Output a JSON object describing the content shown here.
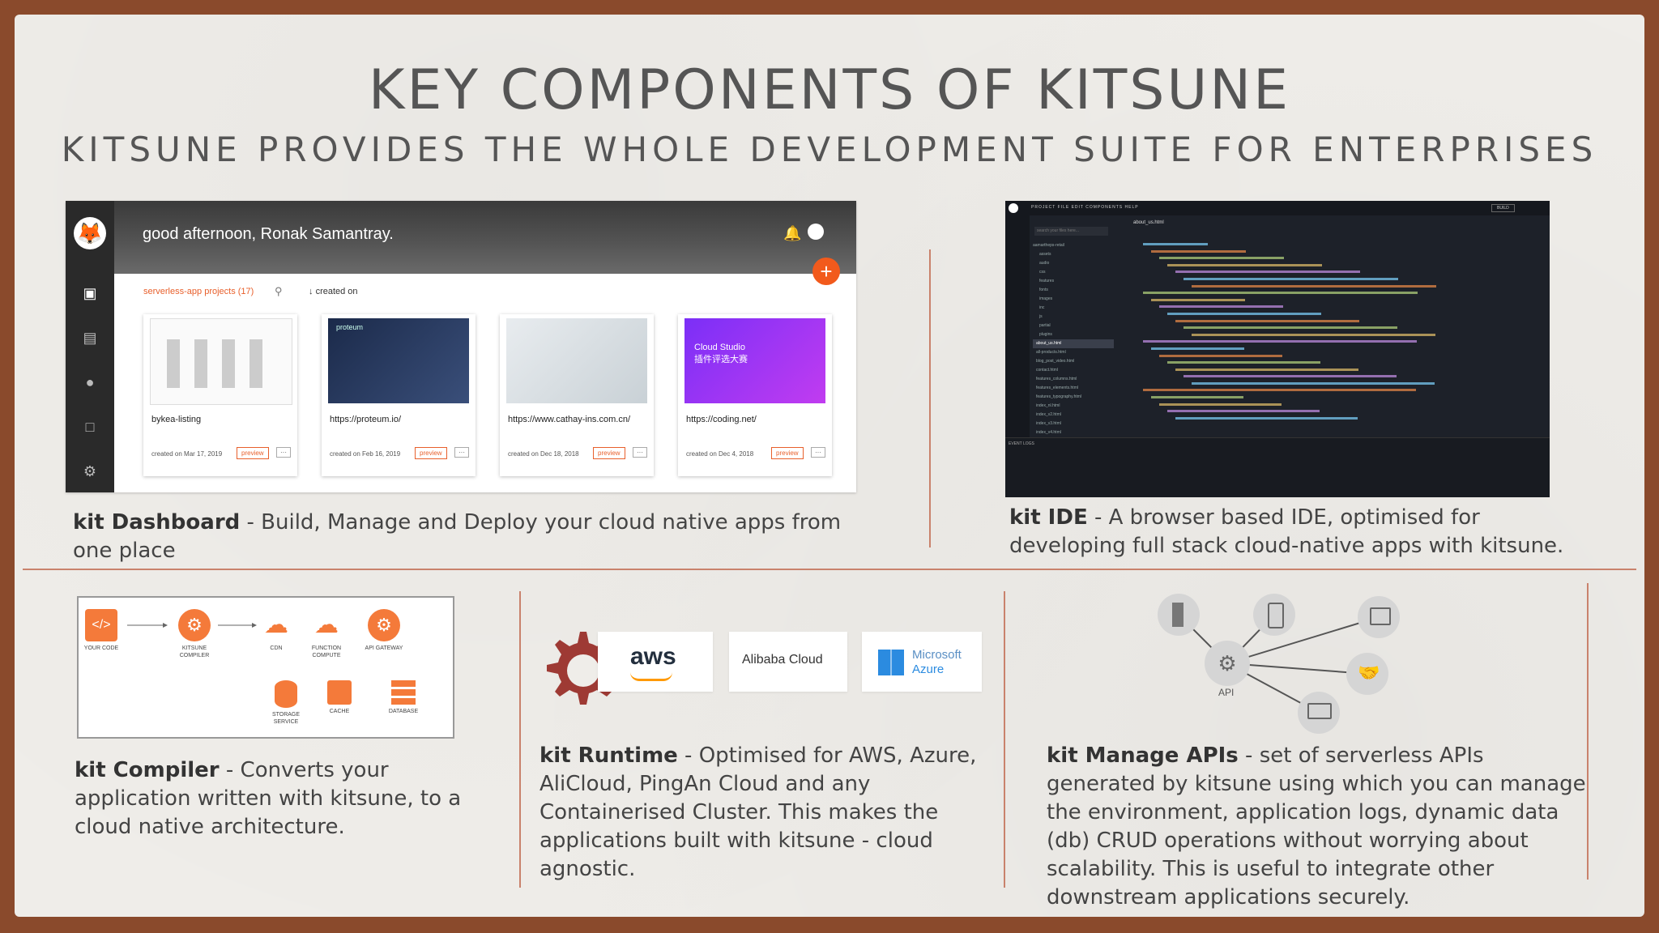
{
  "slide": {
    "title": "KEY COMPONENTS OF KITSUNE",
    "subtitle": "KITSUNE PROVIDES THE WHOLE DEVELOPMENT SUITE FOR ENTERPRISES"
  },
  "dashboard": {
    "greeting": "good afternoon, Ronak Samantray.",
    "filter_label": "serverless-app projects (17)",
    "sort_label": "created on",
    "cards": [
      {
        "name": "bykea-listing",
        "date": "created on Mar 17, 2019",
        "preview": "preview"
      },
      {
        "name": "https://proteum.io/",
        "date": "created on Feb 16, 2019",
        "preview": "preview"
      },
      {
        "name": "https://www.cathay-ins.com.cn/",
        "date": "created on Dec 18, 2018",
        "preview": "preview"
      },
      {
        "name": "https://coding.net/",
        "date": "created on Dec 4, 2018",
        "preview": "preview"
      }
    ],
    "card2_thumb_text": "proteum",
    "card4_thumb_text": "Cloud Studio\n插件评选大赛"
  },
  "captions": {
    "dashboard_bold": "kit Dashboard",
    "dashboard_text": " - Build, Manage and Deploy your cloud native apps from one place",
    "ide_bold": "kit IDE",
    "ide_text": " - A browser based IDE, optimised for developing full stack cloud-native apps with kitsune.",
    "compiler_bold": "kit Compiler",
    "compiler_text": " - Converts your application written with kitsune, to a cloud native architecture.",
    "runtime_bold": "kit Runtime",
    "runtime_text": " - Optimised for AWS, Azure, AliCloud, PingAn Cloud and any Containerised Cluster. This makes the applications built with kitsune - cloud agnostic.",
    "apis_bold": "kit Manage APIs",
    "apis_text": " - set of serverless APIs generated by kitsune using which you can manage the environment, application logs, dynamic data (db) CRUD operations without worrying about scalability. This is useful to integrate other downstream applications securely."
  },
  "ide": {
    "menu": "PROJECT   FILE   EDIT   COMPONENTS   HELP",
    "build": "BUILD",
    "tab": "about_us.html",
    "search_placeholder": "search your files here...",
    "tree": [
      "aamartheps-retail",
      "assets",
      "audio",
      "css",
      "features",
      "fonts",
      "images",
      "inc",
      "js",
      "partial",
      "plugins",
      "about_us.html",
      "all-products.html",
      "blog_post_video.html",
      "contact.html",
      "features_columns.html",
      "features_elements.html",
      "features_typography.html",
      "index_nl.html",
      "index_v2.html",
      "index_v3.html",
      "index_v4.html"
    ],
    "log_title": "EVENT LOGS"
  },
  "compiler": {
    "nodes": [
      "YOUR CODE",
      "KITSUNE COMPILER",
      "CDN",
      "FUNCTION COMPUTE",
      "API GATEWAY",
      "STORAGE SERVICE",
      "CACHE",
      "DATABASE"
    ]
  },
  "runtime": {
    "aws": "aws",
    "alibaba": "Alibaba Cloud",
    "azure_line1": "Microsoft",
    "azure_line2": "Azure"
  },
  "apis": {
    "center_label": "API"
  },
  "colors": {
    "accent": "#e8602c",
    "rule": "#c9826c",
    "border": "#8a4a2c"
  }
}
